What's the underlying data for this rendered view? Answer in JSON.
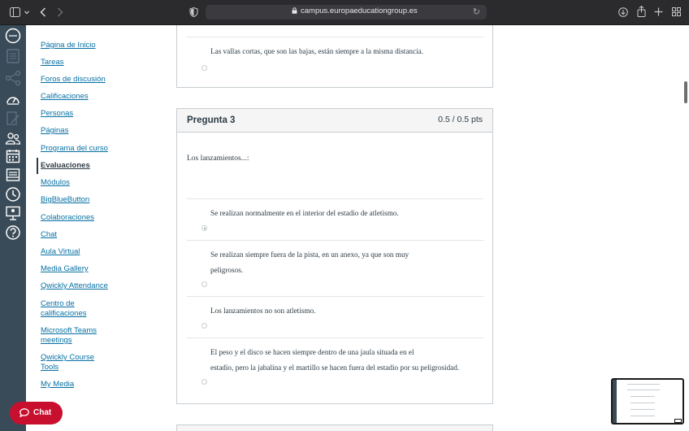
{
  "browser": {
    "url": "campus.europaeducationgroup.es"
  },
  "course_nav": {
    "items": [
      {
        "label": "Página de Inicio"
      },
      {
        "label": "Tareas"
      },
      {
        "label": "Foros de discusión"
      },
      {
        "label": "Calificaciones"
      },
      {
        "label": "Personas"
      },
      {
        "label": "Páginas"
      },
      {
        "label": "Programa del curso"
      },
      {
        "label": "Evaluaciones"
      },
      {
        "label": "Módulos"
      },
      {
        "label": "BigBlueButton"
      },
      {
        "label": "Colaboraciones"
      },
      {
        "label": "Chat"
      },
      {
        "label": "Aula Virtual"
      },
      {
        "label": "Media Gallery"
      },
      {
        "label": "Qwickly Attendance"
      },
      {
        "label": "Centro de calificaciones"
      },
      {
        "label": "Microsoft Teams meetings"
      },
      {
        "label": "Qwickly Course Tools"
      },
      {
        "label": "My Media"
      }
    ],
    "active": "Evaluaciones"
  },
  "previous_question": {
    "last_answer": "Las vallas cortas, que son las bajas, están siempre a la misma distancia."
  },
  "question": {
    "title": "Pregunta 3",
    "points": "0.5 / 0.5 pts",
    "prompt": "Los lanzamientos...:",
    "answers": [
      {
        "line1": "Se realizan normalmente en el interior del estadio de atletismo.",
        "line2": "",
        "selected": true
      },
      {
        "line1": "Se realizan siempre fuera de la pista, en un anexo, ya que son muy",
        "line2": "peligrosos.",
        "selected": false
      },
      {
        "line1": "Los lanzamientos no son atletismo.",
        "line2": "",
        "selected": false
      },
      {
        "line1": "El peso y el disco se hacen siempre dentro de una jaula situada en el",
        "line2": "estadio, pero la jabalina y el martillo se hacen fuera del estadio por su peligrosidad.",
        "selected": false
      }
    ]
  },
  "chat_button": {
    "label": "Chat"
  },
  "colors": {
    "brand_nav": "#394b58",
    "link": "#0770a3",
    "chat_red": "#c8102e"
  },
  "icons": [
    "sidebar-toggle-icon",
    "chevron-down-icon",
    "back-icon",
    "forward-icon",
    "shield-icon",
    "lock-icon",
    "reload-icon",
    "download-icon",
    "share-icon",
    "plus-icon",
    "tab-grid-icon"
  ]
}
